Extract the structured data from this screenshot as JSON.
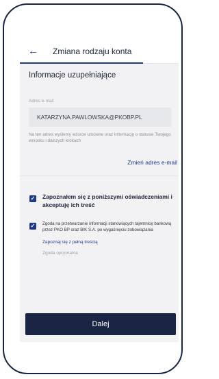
{
  "header": {
    "title": "Zmiana rodzaju konta",
    "back_icon": "←"
  },
  "section": {
    "title": "Informacje uzupełniające"
  },
  "email": {
    "label": "Adres e-mail",
    "value": "KATARZYNA.PAWLOWSKA@PKOBP.PL",
    "note": "Na ten adres wyślemy wzorce umowne oraz informację o statusie Twojego wniosku i dalszych krokach",
    "change_link": "Zmień adres e-mail"
  },
  "consents": {
    "agree_all": {
      "checked": true,
      "text": "Zapoznałem się z poniższymi oświadczeniami i akceptuję ich treść"
    },
    "bank_secrecy": {
      "checked": true,
      "text": "Zgoda na przetwarzanie informacji stanowiących tajemnicę bankową przez PKO BP oraz BIK S.A. po wygaśnięciu zobowiązania",
      "link": "Zapoznaj się z pełną treścią",
      "optional_label": "Zgoda opcjonalna"
    }
  },
  "footer": {
    "next_label": "Dalej"
  },
  "colors": {
    "primary": "#1e3b87",
    "button": "#1a2444",
    "background": "#f2f2f4"
  }
}
